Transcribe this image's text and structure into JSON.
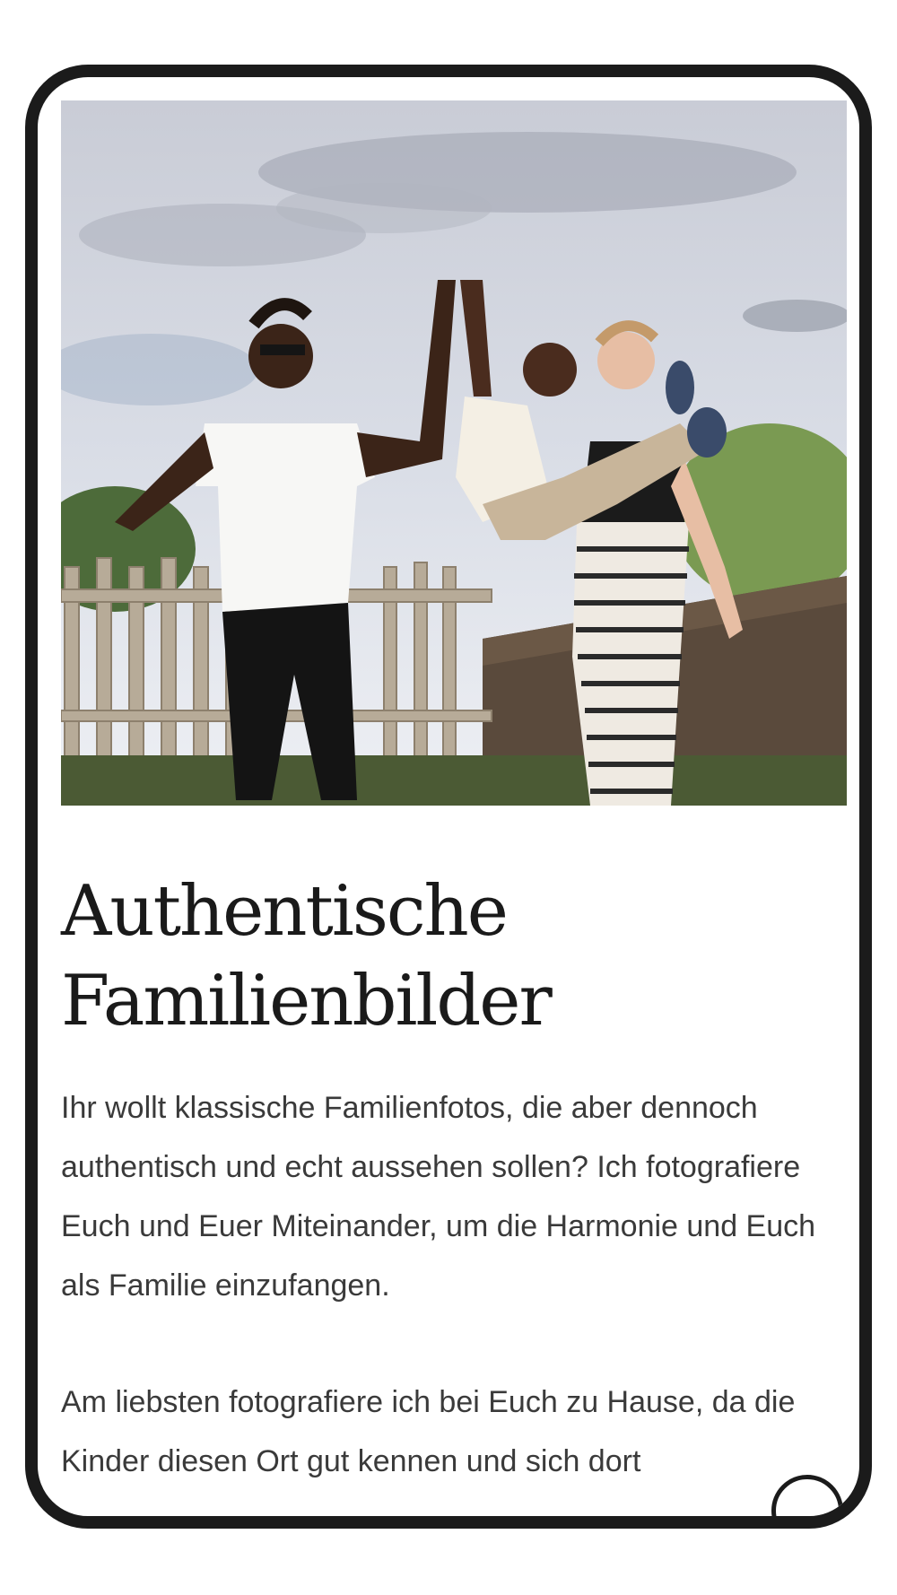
{
  "hero": {
    "image_label": "family-photo"
  },
  "section": {
    "title_line1": "Authentische",
    "title_line2": "Familienbilder",
    "paragraph1": "Ihr wollt klassische Familienfotos, die aber dennoch authentisch und echt aussehen sollen? Ich fotografiere Euch und Euer Miteinander, um die Harmonie und Euch als Familie einzufangen.",
    "paragraph2": "Am liebsten fotografiere ich bei Euch zu Hause, da die Kinder diesen Ort gut kennen und sich dort"
  },
  "colors": {
    "frame": "#1b1b1b",
    "title": "#1a1a1a",
    "body": "#3a3a3a"
  }
}
